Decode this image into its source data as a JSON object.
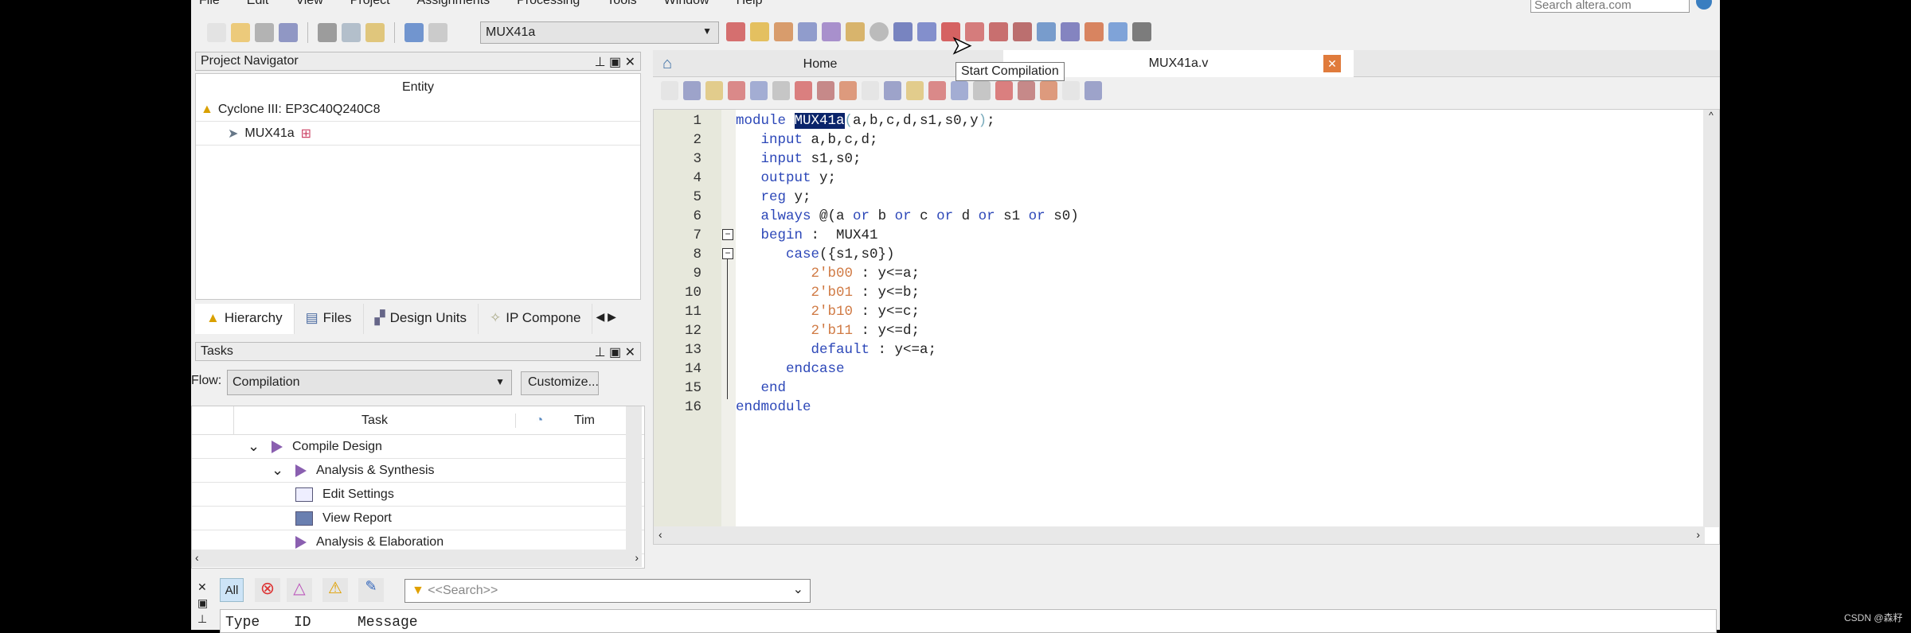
{
  "menu": [
    "File",
    "Edit",
    "View",
    "Project",
    "Assignments",
    "Processing",
    "Tools",
    "Window",
    "Help"
  ],
  "search_web": {
    "placeholder": "Search altera.com"
  },
  "toolbar": {
    "left_icons": [
      "new-file-icon",
      "open-folder-icon",
      "save-icon",
      "save-all-icon",
      "cut-icon",
      "copy-icon",
      "paste-icon",
      "undo-icon",
      "redo-icon"
    ],
    "entity_select": "MUX41a",
    "right_icons": [
      "netlist-icon",
      "pin-planner-icon",
      "assignment-editor-icon",
      "analysis-icon",
      "synthesis-icon",
      "fitter-icon",
      "stop-icon",
      "start-compilation-icon",
      "rtl-viewer-icon",
      "timing-analyzer-icon",
      "timequest-icon",
      "chip-planner-icon",
      "technology-map-icon",
      "programmer-icon",
      "signaltap-icon",
      "ssn-icon",
      "help-icon",
      "feedback-icon"
    ],
    "tooltip": "Start Compilation"
  },
  "navigator": {
    "title": "Project Navigator",
    "column": "Entity",
    "device": "Cyclone III: EP3C40Q240C8",
    "entity": "MUX41a",
    "tabs": [
      "Hierarchy",
      "Files",
      "Design Units",
      "IP Compone"
    ]
  },
  "tasks": {
    "title": "Tasks",
    "flow_label": "Flow:",
    "flow_value": "Compilation",
    "customize": "Customize...",
    "columns": [
      "Task",
      "Tim"
    ],
    "rows": [
      {
        "label": "Compile Design",
        "level": 0,
        "icon": "play-icon",
        "expander": true
      },
      {
        "label": "Analysis & Synthesis",
        "level": 1,
        "icon": "play-icon",
        "expander": true
      },
      {
        "label": "Edit Settings",
        "level": 2,
        "icon": "settings-window-icon"
      },
      {
        "label": "View Report",
        "level": 2,
        "icon": "report-table-icon"
      },
      {
        "label": "Analysis & Elaboration",
        "level": 2,
        "icon": "play-icon"
      }
    ]
  },
  "editor": {
    "tabs": [
      {
        "label": "Home"
      },
      {
        "label": "MUX41a.v",
        "active": true
      }
    ],
    "lines": [
      [
        [
          "module ",
          "kw"
        ],
        [
          "MUX41a",
          "sel"
        ],
        [
          "(",
          "par"
        ],
        [
          "a,b,c,d,s1,s0,y",
          ""
        ],
        [
          ")",
          "par"
        ],
        [
          ";",
          ""
        ]
      ],
      [
        [
          "   input ",
          "kw"
        ],
        [
          "a,b,c,d;",
          ""
        ]
      ],
      [
        [
          "   input ",
          "kw"
        ],
        [
          "s1,s0;",
          ""
        ]
      ],
      [
        [
          "   output ",
          "kw"
        ],
        [
          "y;",
          ""
        ]
      ],
      [
        [
          "   reg ",
          "kw"
        ],
        [
          "y;",
          ""
        ]
      ],
      [
        [
          "   always ",
          "kw"
        ],
        [
          "@(a ",
          ""
        ],
        [
          "or",
          "kw"
        ],
        [
          " b ",
          ""
        ],
        [
          "or",
          "kw"
        ],
        [
          " c ",
          ""
        ],
        [
          "or",
          "kw"
        ],
        [
          " d ",
          ""
        ],
        [
          "or",
          "kw"
        ],
        [
          " s1 ",
          ""
        ],
        [
          "or",
          "kw"
        ],
        [
          " s0)",
          ""
        ]
      ],
      [
        [
          "   begin",
          "kw"
        ],
        [
          " :  MUX41",
          ""
        ]
      ],
      [
        [
          "      case",
          "kw"
        ],
        [
          "({s1,s0})",
          ""
        ]
      ],
      [
        [
          "         2'b00",
          "num"
        ],
        [
          " : y<=a;",
          ""
        ]
      ],
      [
        [
          "         2'b01",
          "num"
        ],
        [
          " : y<=b;",
          ""
        ]
      ],
      [
        [
          "         2'b10",
          "num"
        ],
        [
          " : y<=c;",
          ""
        ]
      ],
      [
        [
          "         2'b11",
          "num"
        ],
        [
          " : y<=d;",
          ""
        ]
      ],
      [
        [
          "         default",
          "kw"
        ],
        [
          " : y<=a;",
          ""
        ]
      ],
      [
        [
          "      endcase",
          "kw"
        ]
      ],
      [
        [
          "   end",
          "kw"
        ]
      ],
      [
        [
          "endmodule",
          "kw"
        ]
      ]
    ],
    "line_numbers": [
      "1",
      "2",
      "3",
      "4",
      "5",
      "6",
      "7",
      "8",
      "9",
      "10",
      "11",
      "12",
      "13",
      "14",
      "15",
      "16"
    ]
  },
  "messages": {
    "filters": [
      "All"
    ],
    "search_placeholder": "<<Search>>",
    "columns": [
      "Type",
      "ID",
      "Message"
    ]
  },
  "watermark": "CSDN @森籽"
}
